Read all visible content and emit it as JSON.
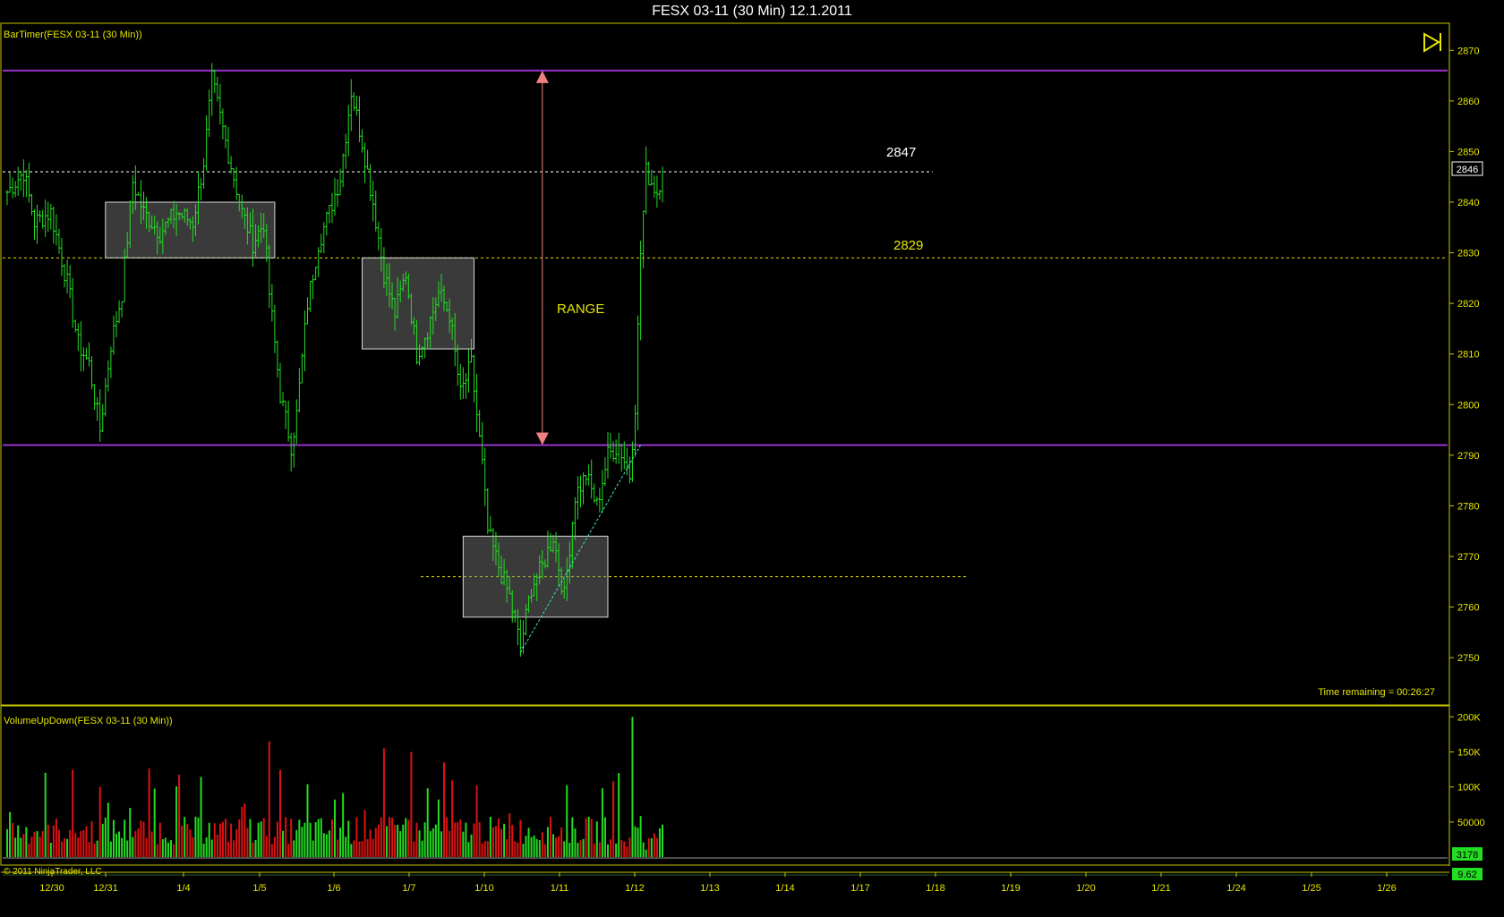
{
  "window": {
    "title": "FESX 03-11 (30 Min)  12.1.2011"
  },
  "price_panel": {
    "indicator_label": "BarTimer(FESX 03-11 (30 Min))",
    "time_remaining": "Time remaining = 00:26:27",
    "current_price_tag": "2846",
    "annotations": {
      "level_high_label": "2847",
      "level_mid_label": "2829",
      "range_label": "RANGE"
    },
    "colors": {
      "frame": "#c8c800",
      "up_bar": "#22dd22",
      "resistance": "#9932cc",
      "dotted_yellow": "#e6e600",
      "range_arrow": "#f08080",
      "trend": "#40e0d0"
    }
  },
  "volume_panel": {
    "indicator_label": "VolumeUpDown(FESX 03-11 (30 Min))",
    "current_volume_tag": "3178",
    "copyright": "© 2011 NinjaTrader, LLC",
    "lower_tag": "9.62"
  },
  "chart_data": [
    {
      "type": "ohlc",
      "title": "FESX 03-11 (30 Min)  12.1.2011",
      "x_tick_labels": [
        "12/30",
        "12/31",
        "1/4",
        "1/5",
        "1/6",
        "1/7",
        "1/10",
        "1/11",
        "1/12",
        "1/13",
        "1/14",
        "1/17",
        "1/18",
        "1/19",
        "1/20",
        "1/21",
        "1/24",
        "1/25",
        "1/26"
      ],
      "y_ticks": [
        2750,
        2760,
        2770,
        2780,
        2790,
        2800,
        2810,
        2820,
        2830,
        2840,
        2850,
        2860,
        2870
      ],
      "ylim": [
        2741,
        2875
      ],
      "horizontal_levels": [
        {
          "price": 2866,
          "style": "solid",
          "color": "#9932cc"
        },
        {
          "price": 2792,
          "style": "solid",
          "color": "#9932cc"
        },
        {
          "price": 2846,
          "style": "dotted",
          "color": "#ffffff",
          "label": "2847"
        },
        {
          "price": 2829,
          "style": "dotted",
          "color": "#e6e600",
          "label": "2829"
        },
        {
          "price": 2766,
          "style": "dotted",
          "color": "#e6e600"
        }
      ],
      "boxes": [
        {
          "x_start_bar": 36,
          "x_end_bar": 98,
          "price_high": 2840,
          "price_low": 2829
        },
        {
          "x_start_bar": 130,
          "x_end_bar": 171,
          "price_high": 2829,
          "price_low": 2811
        },
        {
          "x_start_bar": 167,
          "x_end_bar": 220,
          "price_high": 2774,
          "price_low": 2758
        }
      ],
      "range_arrow": {
        "bar": 196,
        "price_top": 2866,
        "price_bottom": 2792
      },
      "trend_line": {
        "from": {
          "bar": 188,
          "price": 2751
        },
        "to": {
          "bar": 232,
          "price": 2792
        }
      },
      "close_path": [
        [
          0,
          2842
        ],
        [
          6,
          2846
        ],
        [
          10,
          2836
        ],
        [
          16,
          2838
        ],
        [
          22,
          2824
        ],
        [
          26,
          2812
        ],
        [
          30,
          2808
        ],
        [
          34,
          2795
        ],
        [
          38,
          2812
        ],
        [
          42,
          2822
        ],
        [
          46,
          2844
        ],
        [
          50,
          2838
        ],
        [
          56,
          2834
        ],
        [
          62,
          2838
        ],
        [
          68,
          2836
        ],
        [
          72,
          2848
        ],
        [
          75,
          2864
        ],
        [
          80,
          2852
        ],
        [
          86,
          2838
        ],
        [
          90,
          2832
        ],
        [
          94,
          2836
        ],
        [
          96,
          2822
        ],
        [
          98,
          2812
        ],
        [
          100,
          2802
        ],
        [
          104,
          2792
        ],
        [
          106,
          2798
        ],
        [
          110,
          2820
        ],
        [
          114,
          2832
        ],
        [
          118,
          2838
        ],
        [
          122,
          2845
        ],
        [
          126,
          2862
        ],
        [
          130,
          2852
        ],
        [
          134,
          2840
        ],
        [
          138,
          2826
        ],
        [
          142,
          2818
        ],
        [
          146,
          2826
        ],
        [
          150,
          2810
        ],
        [
          154,
          2815
        ],
        [
          158,
          2822
        ],
        [
          162,
          2818
        ],
        [
          166,
          2802
        ],
        [
          170,
          2808
        ],
        [
          174,
          2788
        ],
        [
          176,
          2775
        ],
        [
          180,
          2768
        ],
        [
          184,
          2762
        ],
        [
          188,
          2752
        ],
        [
          192,
          2764
        ],
        [
          196,
          2768
        ],
        [
          200,
          2774
        ],
        [
          204,
          2762
        ],
        [
          208,
          2782
        ],
        [
          212,
          2786
        ],
        [
          216,
          2780
        ],
        [
          220,
          2790
        ],
        [
          224,
          2792
        ],
        [
          228,
          2786
        ],
        [
          230,
          2800
        ],
        [
          232,
          2830
        ],
        [
          234,
          2846
        ],
        [
          238,
          2842
        ],
        [
          240,
          2846
        ]
      ]
    },
    {
      "type": "bar",
      "title": "VolumeUpDown(FESX 03-11 (30 Min))",
      "y_ticks": [
        50000,
        100000,
        150000,
        200000
      ],
      "y_tick_labels": [
        "50000",
        "100K",
        "150K",
        "200K"
      ],
      "ylim": [
        0,
        208000
      ],
      "notable_bars": [
        {
          "bar": 96,
          "value": 165000,
          "direction": "down"
        },
        {
          "bar": 138,
          "value": 155000,
          "direction": "down"
        },
        {
          "bar": 148,
          "value": 150000,
          "direction": "down"
        },
        {
          "bar": 160,
          "value": 135000,
          "direction": "down"
        },
        {
          "bar": 229,
          "value": 200000,
          "direction": "up"
        }
      ]
    }
  ]
}
